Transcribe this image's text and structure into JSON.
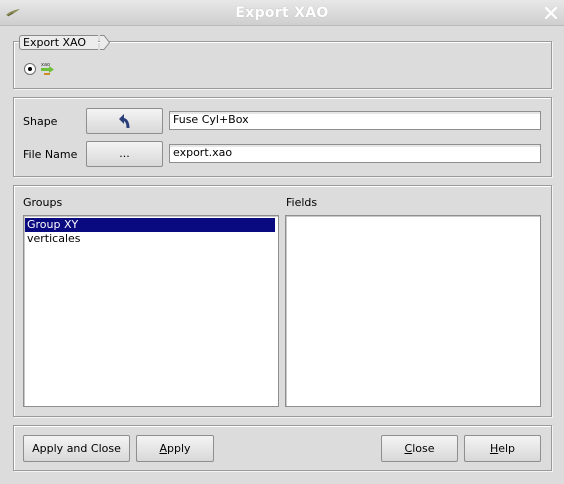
{
  "window": {
    "title": "Export XAO",
    "close_glyph": "✕",
    "icon": "app-feather-icon"
  },
  "mode": {
    "tab_label": "Export XAO",
    "radio_selected": true,
    "radio_icon": "xao-export-icon"
  },
  "shape": {
    "label": "Shape",
    "select_icon": "curved-arrow-select-icon",
    "value": "Fuse Cyl+Box"
  },
  "file": {
    "label": "File Name",
    "browse_label": "...",
    "value": "export.xao"
  },
  "groups": {
    "label": "Groups",
    "items": [
      {
        "label": "Group XY",
        "selected": true
      },
      {
        "label": "verticales",
        "selected": false
      }
    ]
  },
  "fields": {
    "label": "Fields",
    "items": []
  },
  "buttons": {
    "apply_close": "Apply and Close",
    "apply_u": "A",
    "apply_rest": "pply",
    "close_u": "C",
    "close_rest": "lose",
    "help_u": "H",
    "help_rest": "elp"
  },
  "colors": {
    "selection": "#0a0a80",
    "background": "#dcdcdc"
  }
}
